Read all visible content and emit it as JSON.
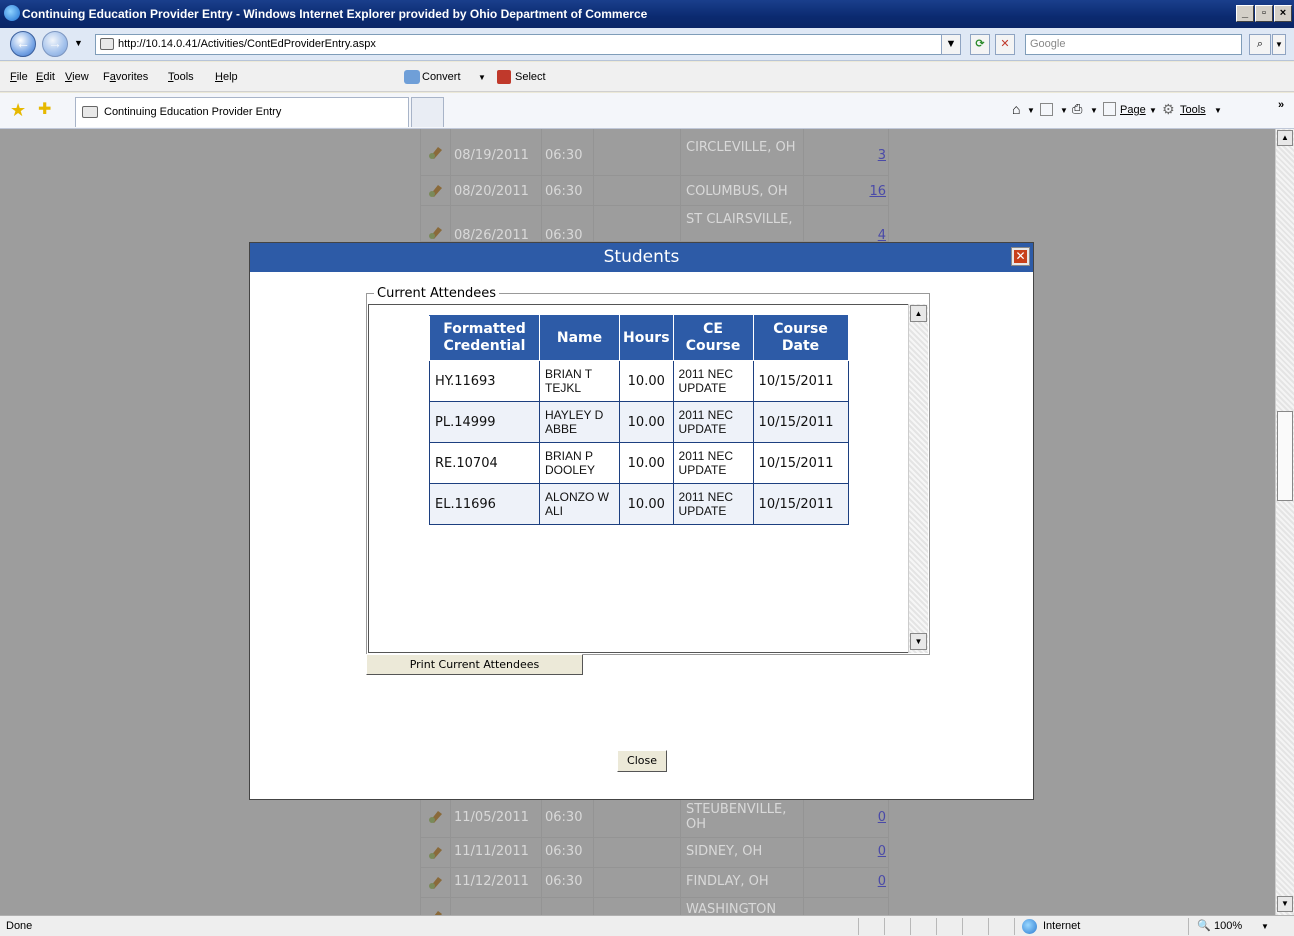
{
  "window": {
    "title": "Continuing Education Provider Entry - Windows Internet Explorer provided by Ohio Department of Commerce",
    "controls": [
      "_",
      "▫",
      "×"
    ]
  },
  "address": {
    "url": "http://10.14.0.41/Activities/ContEdProviderEntry.aspx",
    "search_placeholder": "Google"
  },
  "menu": {
    "items": [
      {
        "label": "File"
      },
      {
        "label": "Edit"
      },
      {
        "label": "View"
      },
      {
        "label": "Favorites"
      },
      {
        "label": "Tools"
      },
      {
        "label": "Help"
      }
    ],
    "convert_label": "Convert",
    "select_label": "Select"
  },
  "favorites": {
    "tab_title": "Continuing Education Provider Entry",
    "page_label": "Page",
    "tools_label": "Tools"
  },
  "background_rows": [
    {
      "date": "08/19/2011",
      "time": "06:30",
      "city": "CIRCLEVILLE, OH",
      "count": "3"
    },
    {
      "date": "08/20/2011",
      "time": "06:30",
      "city": "COLUMBUS, OH",
      "count": "16"
    },
    {
      "date": "08/26/2011",
      "time": "06:30",
      "city": "ST CLAIRSVILLE,",
      "count": "4"
    },
    {
      "date": "11/05/2011",
      "time": "06:30",
      "city": "STEUBENVILLE, OH",
      "count": "0"
    },
    {
      "date": "11/11/2011",
      "time": "06:30",
      "city": "SIDNEY, OH",
      "count": "0"
    },
    {
      "date": "11/12/2011",
      "time": "06:30",
      "city": "FINDLAY, OH",
      "count": "0"
    },
    {
      "date": "",
      "time": "",
      "city": "WASHINGTON",
      "count": ""
    }
  ],
  "modal": {
    "title": "Students",
    "legend": "Current Attendees",
    "columns": [
      "Formatted Credential",
      "Name",
      "Hours",
      "CE Course",
      "Course Date"
    ],
    "rows": [
      {
        "credential": "HY.11693",
        "name": "BRIAN T TEJKL",
        "hours": "10.00",
        "course": "2011 NEC UPDATE",
        "date": "10/15/2011"
      },
      {
        "credential": "PL.14999",
        "name": "HAYLEY D ABBE",
        "hours": "10.00",
        "course": "2011 NEC UPDATE",
        "date": "10/15/2011"
      },
      {
        "credential": "RE.10704",
        "name": "BRIAN P DOOLEY",
        "hours": "10.00",
        "course": "2011 NEC UPDATE",
        "date": "10/15/2011"
      },
      {
        "credential": "EL.11696",
        "name": "ALONZO W ALI",
        "hours": "10.00",
        "course": "2011 NEC UPDATE",
        "date": "10/15/2011"
      }
    ],
    "print_label": "Print Current Attendees",
    "close_label": "Close"
  },
  "status": {
    "text": "Done",
    "zone": "Internet",
    "zoom": "100%"
  },
  "colors": {
    "header_blue": "#2d5ba7",
    "overlay_gray": "#9d9d9d"
  }
}
